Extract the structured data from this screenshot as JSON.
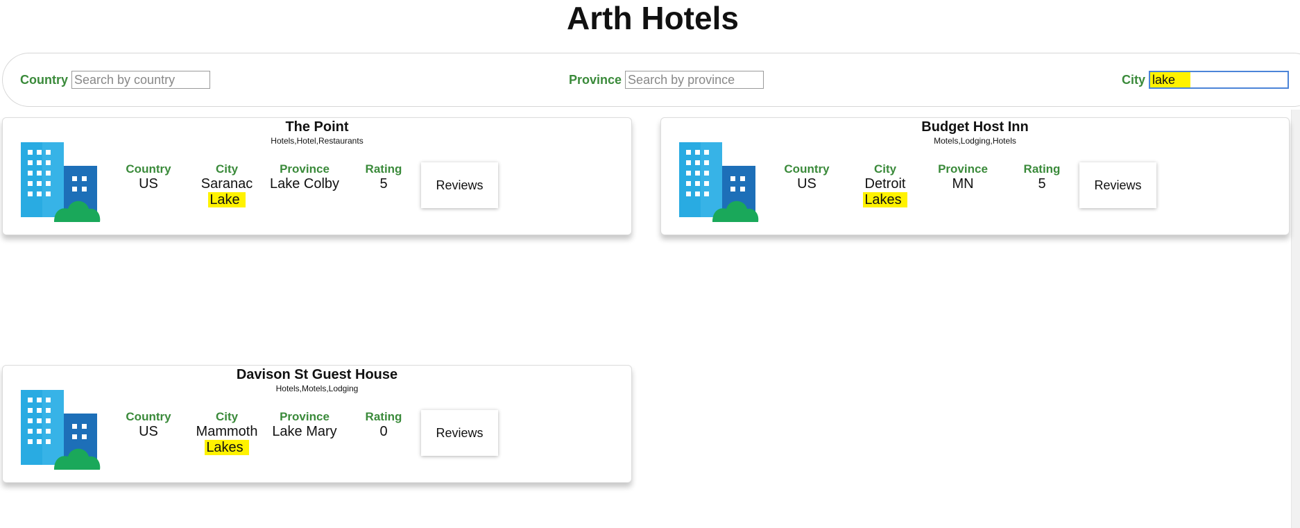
{
  "app": {
    "title": "Arth Hotels"
  },
  "search": {
    "country": {
      "label": "Country",
      "placeholder": "Search by country",
      "value": ""
    },
    "province": {
      "label": "Province",
      "placeholder": "Search by province",
      "value": ""
    },
    "city": {
      "label": "City",
      "placeholder": "",
      "value": "lake"
    }
  },
  "labels": {
    "country": "Country",
    "city": "City",
    "province": "Province",
    "rating": "Rating",
    "reviews": "Reviews"
  },
  "colors": {
    "label_green": "#3a8a3a",
    "highlight": "#fff200",
    "building_light": "#29abe2",
    "building_dark": "#1d6fb8",
    "tree": "#1aa85a"
  },
  "hotels": [
    {
      "name": "The Point",
      "categories": "Hotels,Hotel,Restaurants",
      "country": "US",
      "city_line1": "Saranac",
      "city_line2": "Lake",
      "province": "Lake Colby",
      "rating": "5",
      "icon": "hotel-building-icon"
    },
    {
      "name": "Budget Host Inn",
      "categories": "Motels,Lodging,Hotels",
      "country": "US",
      "city_line1": "Detroit",
      "city_line2": "Lakes",
      "province": "MN",
      "rating": "5",
      "icon": "hotel-building-icon"
    },
    {
      "name": "Davison St Guest House",
      "categories": "Hotels,Motels,Lodging",
      "country": "US",
      "city_line1": "Mammoth",
      "city_line2": "Lakes",
      "province": "Lake Mary",
      "rating": "0",
      "icon": "hotel-building-icon"
    }
  ]
}
